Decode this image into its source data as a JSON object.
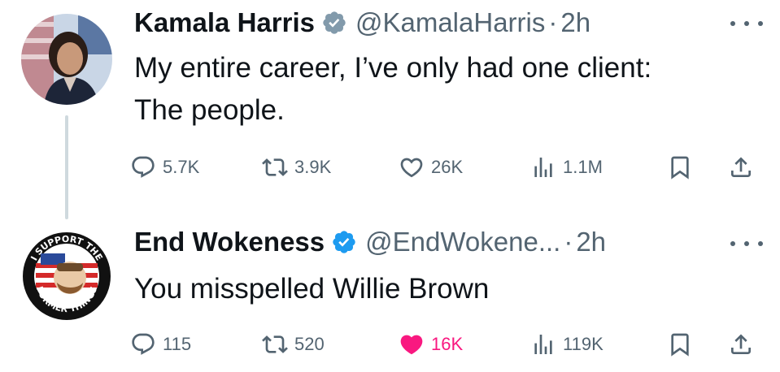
{
  "tweets": [
    {
      "display_name": "Kamala Harris",
      "handle": "@KamalaHarris",
      "separator": "·",
      "time": "2h",
      "text_lines": [
        "My entire career, I’ve only had one client:",
        "The people."
      ],
      "replies": "5.7K",
      "retweets": "3.9K",
      "likes": "26K",
      "views": "1.1M",
      "liked": false,
      "verified_color": "#829aab"
    },
    {
      "display_name": "End Wokeness",
      "handle": "@EndWokene...",
      "separator": "·",
      "time": "2h",
      "text_lines": [
        "You misspelled Willie Brown"
      ],
      "replies": "115",
      "retweets": "520",
      "likes": "16K",
      "views": "119K",
      "liked": true,
      "verified_color": "#1d9bf0",
      "avatar_text_top": "I SUPPORT THE",
      "avatar_text_bottom": "FORMER THINGS"
    }
  ],
  "colors": {
    "text": "#0f1419",
    "secondary": "#536471",
    "like_active": "#f91880",
    "thread_line": "#cfd9de"
  }
}
